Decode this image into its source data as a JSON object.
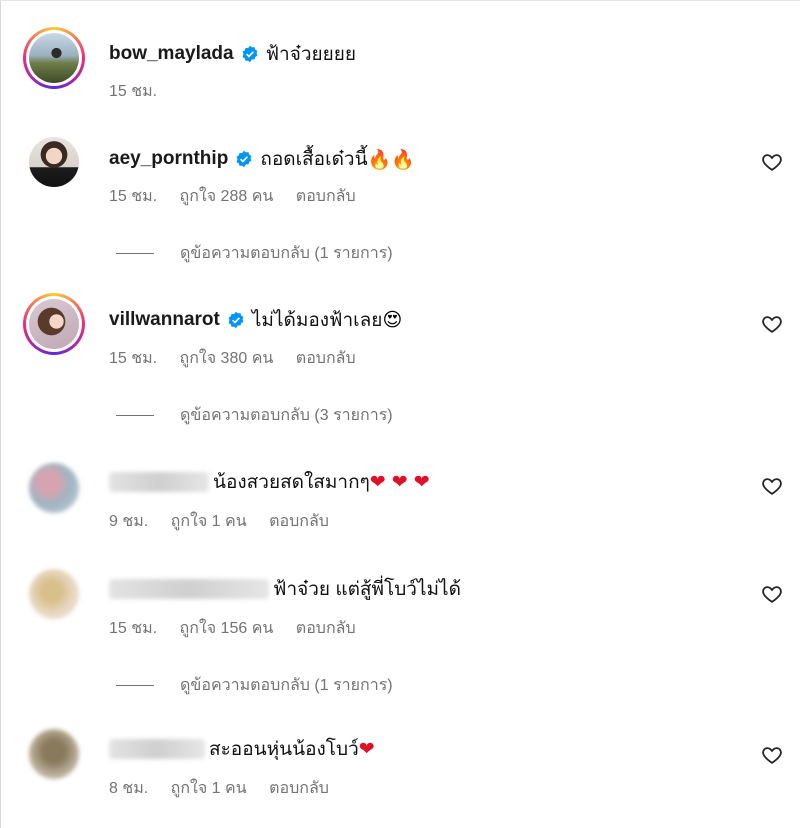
{
  "caption": {
    "username": "bow_maylada",
    "verified": true,
    "text": "ฟ้าจ๋วยยยย",
    "time": "15 ชม."
  },
  "comments": [
    {
      "username": "aey_pornthip",
      "verified": true,
      "text": "ถอดเสื้อเด๋วนี้ ",
      "emoji": "🔥🔥",
      "time": "15 ชม.",
      "likes": "ถูกใจ 288 คน",
      "reply_label": "ตอบกลับ",
      "view_replies": "ดูข้อความตอบกลับ (1 รายการ)"
    },
    {
      "username": "villwannarot",
      "verified": true,
      "text": "ไม่ได้มองฟ้าเลย",
      "emoji": "😍",
      "time": "15 ชม.",
      "likes": "ถูกใจ 380 คน",
      "reply_label": "ตอบกลับ",
      "view_replies": "ดูข้อความตอบกลับ (3 รายการ)"
    },
    {
      "text": "น้องสวยสดใสมากๆ",
      "emoji": "❤ ❤ ❤",
      "time": "9 ชม.",
      "likes": "ถูกใจ 1 คน",
      "reply_label": "ตอบกลับ"
    },
    {
      "text": "ฟ้าจ๋วย แต่สู้พี่โบว์ไม่ได้",
      "time": "15 ชม.",
      "likes": "ถูกใจ 156 คน",
      "reply_label": "ตอบกลับ",
      "view_replies": "ดูข้อความตอบกลับ (1 รายการ)"
    },
    {
      "text": "สะออนหุ่นน้องโบว์",
      "emoji": "❤",
      "time": "8 ชม.",
      "likes": "ถูกใจ 1 คน",
      "reply_label": "ตอบกลับ"
    }
  ],
  "icons": {
    "verified": "verified-badge-icon",
    "like": "heart-outline-icon"
  },
  "colors": {
    "verified": "#0095f6",
    "meta": "#737373",
    "ring_start": "#f9ce34",
    "ring_mid": "#ee2a7b"
  }
}
